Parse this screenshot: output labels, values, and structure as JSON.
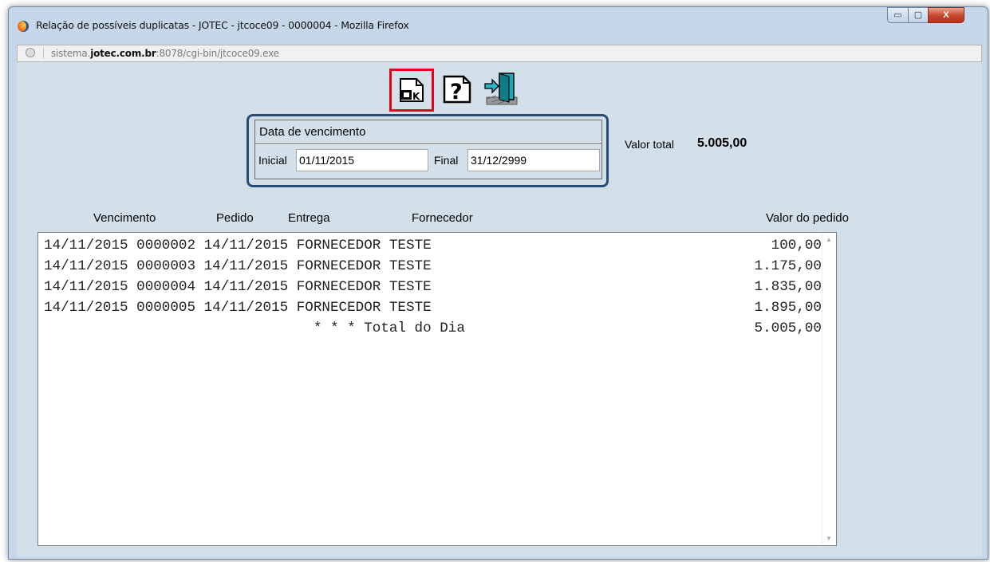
{
  "window": {
    "title": "Relação de possíveis duplicatas - JOTEC - jtcoce09 - 0000004 - Mozilla Firefox",
    "url_prefix": "sistema.",
    "url_domain": "jotec.com.br",
    "url_path": ":8078/cgi-bin/jtcoce09.exe",
    "minimize": "▭",
    "maximize": "▢",
    "close": "X"
  },
  "toolbar": {
    "icons": [
      "ok-icon",
      "help-icon",
      "exit-icon"
    ],
    "ok_text": "OK",
    "help_text": "?"
  },
  "filter": {
    "legend": "Data de vencimento",
    "inicial_label": "Inicial",
    "inicial_value": "01/11/2015",
    "final_label": "Final",
    "final_value": "31/12/2999"
  },
  "summary": {
    "label": "Valor total",
    "value": "5.005,00"
  },
  "columns": {
    "vencimento": "Vencimento",
    "pedido": "Pedido",
    "entrega": "Entrega",
    "fornecedor": "Fornecedor",
    "valor": "Valor do pedido"
  },
  "rows": [
    {
      "text": "14/11/2015 0000002 14/11/2015 FORNECEDOR TESTE",
      "amount": "100,00"
    },
    {
      "text": "14/11/2015 0000003 14/11/2015 FORNECEDOR TESTE",
      "amount": "1.175,00"
    },
    {
      "text": "14/11/2015 0000004 14/11/2015 FORNECEDOR TESTE",
      "amount": "1.835,00"
    },
    {
      "text": "14/11/2015 0000005 14/11/2015 FORNECEDOR TESTE",
      "amount": "1.895,00"
    },
    {
      "text": "                                * * * Total do Dia",
      "amount": "5.005,00"
    }
  ],
  "colors": {
    "background": "#d3e0ea",
    "ok_highlight": "#e4001a",
    "date_box_border": "#2b4a75"
  }
}
